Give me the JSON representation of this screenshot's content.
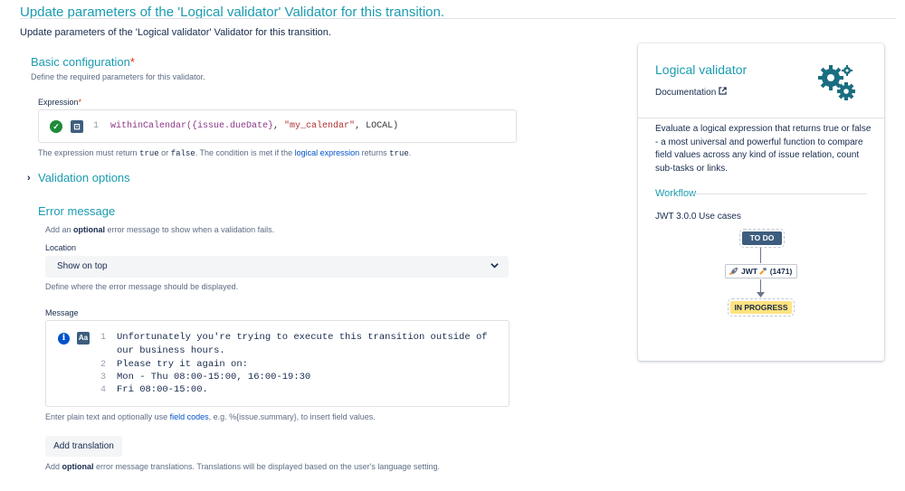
{
  "header": {
    "title": "Update parameters of the 'Logical validator' Validator for this transition.",
    "subtitle": "Update parameters of the 'Logical validator' Validator for this transition."
  },
  "basic": {
    "title": "Basic configuration",
    "required_mark": "*",
    "help": "Define the required parameters for this validator.",
    "expression_label": "Expression",
    "expression": {
      "line_number": "1",
      "fn": "withinCalendar(",
      "field": "{issue.dueDate}",
      "comma1": ", ",
      "calendar": "\"my_calendar\"",
      "rest": ", LOCAL)"
    },
    "note": {
      "p1": "The expression must return ",
      "true": "true",
      "or": " or ",
      "false": "false",
      "p2": ". The condition is met if the ",
      "link": "logical expression",
      "p3": " returns ",
      "true2": "true",
      "p4": "."
    }
  },
  "validation_options": {
    "title": "Validation options"
  },
  "error": {
    "title": "Error message",
    "help_p1": "Add an ",
    "help_bold": "optional",
    "help_p2": " error message to show when a validation fails.",
    "location_label": "Location",
    "location_value": "Show on top",
    "location_help": "Define where the error message should be displayed.",
    "message_label": "Message",
    "message_lines": [
      {
        "num": "1",
        "text": "Unfortunately you're trying to execute this transition outside of"
      },
      {
        "num": "",
        "text": "our business hours."
      },
      {
        "num": "2",
        "text": "Please try it again on:"
      },
      {
        "num": "3",
        "text": "Mon - Thu 08:00-15:00, 16:00-19:30"
      },
      {
        "num": "4",
        "text": "Fri 08:00-15:00."
      }
    ],
    "message_help_p1": "Enter plain text and optionally use ",
    "message_help_link": "field codes",
    "message_help_p2": ", e.g. %{issue.summary}, to insert field values.",
    "add_translation": "Add translation",
    "translation_help_p1": "Add ",
    "translation_help_bold": "optional",
    "translation_help_p2": " error message translations. Translations will be displayed based on the user's language setting."
  },
  "card": {
    "title": "Logical validator",
    "documentation": "Documentation",
    "description": "Evaluate a logical expression that returns true or false - a most universal and powerful function to compare field values across any kind of issue relation, count sub-tasks or links.",
    "workflow_title": "Workflow",
    "use_case": "JWT 3.0.0 Use cases",
    "status_from": "TO DO",
    "transition": "JWT",
    "transition_count": "(1471)",
    "status_to": "IN PROGRESS"
  },
  "colors": {
    "accent": "#1a9bb0",
    "todo": "#3d5d7e",
    "inprogress": "#ffe380",
    "ok": "#1f8a3a"
  }
}
